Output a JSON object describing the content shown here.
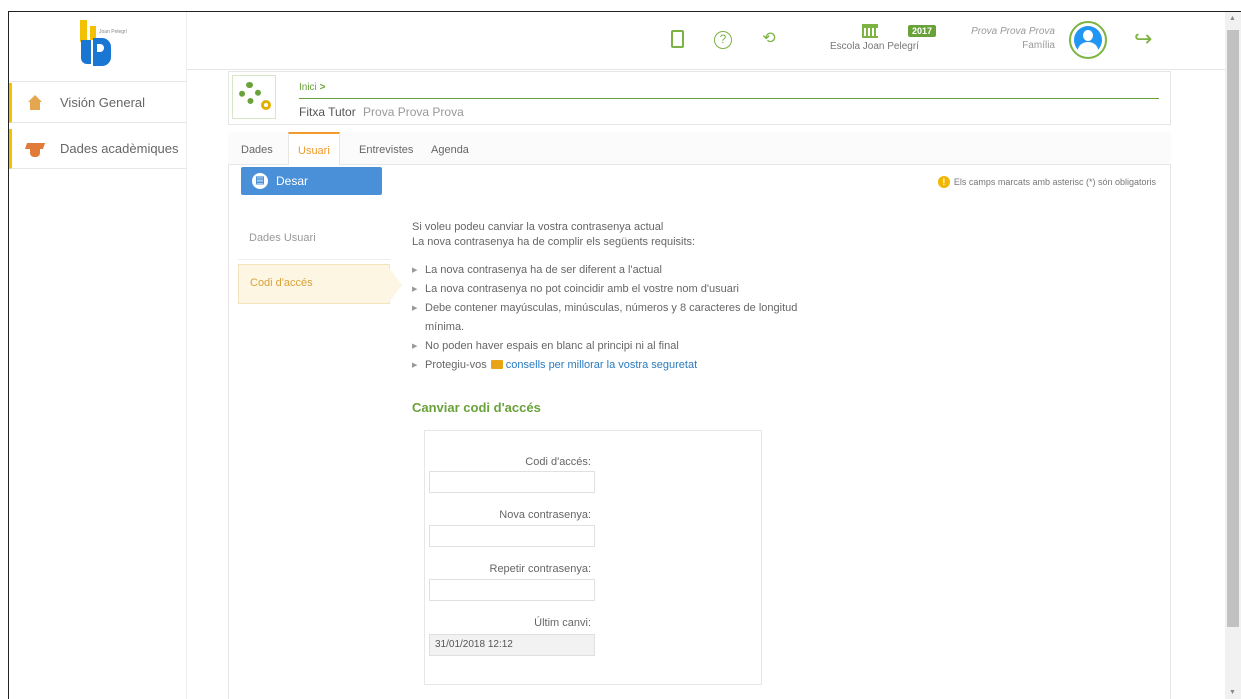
{
  "sidebar": {
    "logo_small": "Joan Pelegrí",
    "items": [
      {
        "label": "Visión General",
        "icon": "house-icon"
      },
      {
        "label": "Dades acadèmiques",
        "icon": "graduation-cap-icon"
      }
    ]
  },
  "topbar": {
    "icons": [
      "phone-icon",
      "help-icon",
      "history-icon"
    ],
    "school_name": "Escola Joan Pelegrí",
    "year_badge": "2017",
    "user_name": "Prova Prova Prova",
    "user_role": "Família"
  },
  "header": {
    "breadcrumb": "Inici",
    "breadcrumb_sep": ">",
    "title": "Fitxa Tutor",
    "subtitle": "Prova Prova Prova"
  },
  "tabs": [
    "Dades",
    "Usuari",
    "Entrevistes",
    "Agenda"
  ],
  "active_tab": "Usuari",
  "toolbar": {
    "save_label": "Desar",
    "required_note": "Els camps marcats amb asterisc (*) són obligatoris"
  },
  "side_menu": [
    {
      "label": "Dades Usuari",
      "active": false
    },
    {
      "label": "Codi d'accés",
      "active": true
    }
  ],
  "info": {
    "line1": "Si voleu podeu canviar la vostra contrasenya actual",
    "line2": "La nova contrasenya ha de complir els següents requisits:",
    "rules": [
      "La nova contrasenya ha de ser diferent a l'actual",
      "La nova contrasenya no pot coincidir amb el vostre nom d'usuari",
      "Debe contener mayúsculas, minúsculas, números y 8 caracteres de longitud mínima.",
      "No poden haver espais en blanc al principi ni al final"
    ],
    "protect_prefix": "Protegiu-vos",
    "protect_link": "consells per millorar la vostra seguretat"
  },
  "form": {
    "section_title": "Canviar codi d'accés",
    "fields": [
      {
        "label": "Codi d'accés:",
        "value": ""
      },
      {
        "label": "Nova contrasenya:",
        "value": ""
      },
      {
        "label": "Repetir contrasenya:",
        "value": ""
      },
      {
        "label": "Últim canvi:",
        "value": "31/01/2018 12:12"
      }
    ]
  },
  "colors": {
    "accent_green": "#6aa23a",
    "primary_blue": "#4a90d9",
    "tab_active": "#f09b2c",
    "sidebar_accent": "#f2c100"
  }
}
